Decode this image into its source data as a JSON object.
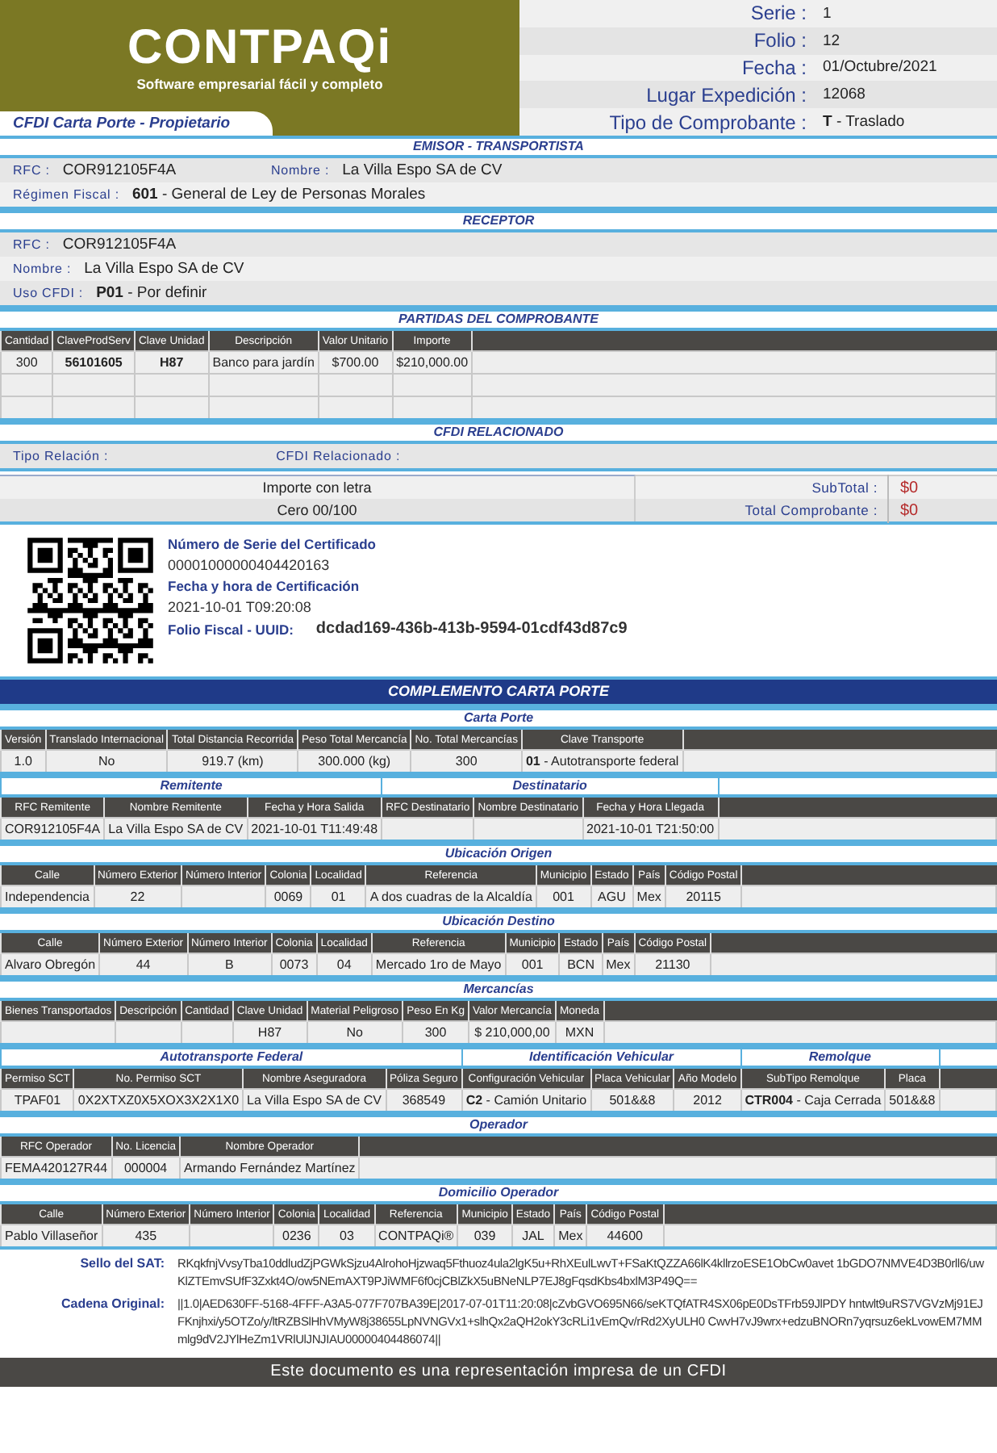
{
  "sections": [
    {
      "kind": "header",
      "logo": "CONTPAQi",
      "tagline": "Software empresarial fácil y completo",
      "doc_title": "CFDI Carta Porte - Propietario",
      "fields": [
        {
          "label": "Serie :",
          "value": "1"
        },
        {
          "label": "Folio :",
          "value": "12"
        },
        {
          "label": "Fecha :",
          "value": "01/Octubre/2021"
        },
        {
          "label": "Lugar Expedición :",
          "value": "12068"
        },
        {
          "label": "Tipo de Comprobante :",
          "value": "**T** - Traslado"
        }
      ]
    },
    {
      "kind": "title",
      "title": "EMISOR - TRANSPORTISTA"
    },
    {
      "kind": "fields",
      "rows": [
        [
          {
            "label": "RFC :",
            "value": "COR912105F4A"
          },
          {
            "label": "Nombre :",
            "value": "La Villa Espo SA de CV"
          }
        ],
        [
          {
            "label": "Régimen Fiscal :",
            "value": "**601** - General de Ley de Personas Morales"
          }
        ]
      ]
    },
    {
      "kind": "title",
      "title": "RECEPTOR"
    },
    {
      "kind": "fields",
      "rows": [
        [
          {
            "label": "RFC :",
            "value": "COR912105F4A"
          }
        ],
        [
          {
            "label": "Nombre :",
            "value": "La Villa Espo SA de CV"
          }
        ],
        [
          {
            "label": "Uso CFDI :",
            "value": "**P01** - Por definir"
          }
        ]
      ]
    },
    {
      "kind": "title",
      "title": "PARTIDAS DEL COMPROBANTE"
    },
    {
      "kind": "table",
      "columns": [
        {
          "label": "Cantidad",
          "bold": false
        },
        {
          "label": "ClaveProdServ",
          "bold": true
        },
        {
          "label": "Clave Unidad",
          "bold": true
        },
        {
          "label": "Descripción",
          "bold": false
        },
        {
          "label": "Valor Unitario",
          "bold": false
        },
        {
          "label": "Importe",
          "bold": false
        }
      ],
      "rows": [
        [
          "300",
          "56101605",
          "H87",
          "Banco para jardín",
          "$700.00",
          "$210,000.00"
        ],
        [
          null,
          null,
          null,
          null,
          null,
          null
        ],
        [
          null,
          null,
          null,
          null,
          null,
          null
        ]
      ]
    },
    {
      "kind": "title",
      "title": "CFDI RELACIONADO"
    },
    {
      "kind": "fields",
      "rows": [
        [
          {
            "label": "Tipo Relación :"
          },
          {
            "label": "CFDI Relacionado :"
          }
        ]
      ]
    },
    {
      "kind": "totals",
      "words_label": "Importe con letra",
      "words": "Cero  00/100",
      "subtotal_label": "SubTotal :",
      "subtotal": "$0",
      "total_label": "Total Comprobante :",
      "total": "$0"
    },
    {
      "kind": "certificate",
      "serial_label": "Número de Serie del Certificado",
      "serial": "00001000000404420163",
      "date_label": "Fecha y hora de Certificación",
      "date": "2021-10-01 T09:20:08",
      "uuid_label": "Folio  Fiscal  - UUID:",
      "uuid": "dcdad169-436b-413b-9594-01cdf43d87c9"
    },
    {
      "kind": "band",
      "title": "COMPLEMENTO CARTA PORTE"
    },
    {
      "kind": "title",
      "title": "Carta Porte"
    },
    {
      "kind": "table",
      "columns": [
        {
          "label": "Versión"
        },
        {
          "label": "Translado Internacional"
        },
        {
          "label": "Total Distancia Recorrida"
        },
        {
          "label": "Peso Total Mercancía"
        },
        {
          "label": "No. Total Mercancías"
        },
        {
          "label": "Clave Transporte"
        }
      ],
      "rows": [
        [
          "1.0",
          "No",
          "919.7 (km)",
          "300.000 (kg)",
          "300",
          "**01** - Autotransporte federal"
        ]
      ]
    },
    {
      "kind": "table",
      "groups": [
        {
          "title": "Remitente",
          "columns": [
            {
              "label": "RFC Remitente"
            },
            {
              "label": "Nombre Remitente"
            },
            {
              "label": "Fecha y Hora Salida"
            }
          ]
        },
        {
          "title": "Destinatario",
          "columns": [
            {
              "label": "RFC Destinatario"
            },
            {
              "label": "Nombre Destinatario"
            },
            {
              "label": "Fecha y Hora Llegada"
            }
          ]
        }
      ],
      "rows": [
        [
          "COR912105F4A",
          "La Villa Espo SA de CV",
          "2021-10-01 T11:49:48",
          null,
          null,
          "2021-10-01 T21:50:00"
        ]
      ]
    },
    {
      "kind": "title",
      "title": "Ubicación Origen"
    },
    {
      "kind": "table",
      "columns": [
        {
          "label": "Calle"
        },
        {
          "label": "Número Exterior"
        },
        {
          "label": "Número Interior"
        },
        {
          "label": "Colonia"
        },
        {
          "label": "Localidad"
        },
        {
          "label": "Referencia"
        },
        {
          "label": "Municipio"
        },
        {
          "label": "Estado"
        },
        {
          "label": "País"
        },
        {
          "label": "Código Postal"
        }
      ],
      "rows": [
        [
          "Independencia",
          "22",
          null,
          "0069",
          "01",
          "A dos cuadras de la Alcaldía",
          "001",
          "AGU",
          "Mex",
          "20115"
        ]
      ]
    },
    {
      "kind": "title",
      "title": "Ubicación Destino"
    },
    {
      "kind": "table",
      "columns": [
        {
          "label": "Calle"
        },
        {
          "label": "Número Exterior"
        },
        {
          "label": "Número Interior"
        },
        {
          "label": "Colonia"
        },
        {
          "label": "Localidad"
        },
        {
          "label": "Referencia"
        },
        {
          "label": "Municipio"
        },
        {
          "label": "Estado"
        },
        {
          "label": "País"
        },
        {
          "label": "Código Postal"
        }
      ],
      "rows": [
        [
          "Alvaro Obregón",
          "44",
          "B",
          "0073",
          "04",
          "Mercado 1ro de Mayo",
          "001",
          "BCN",
          "Mex",
          "21130"
        ]
      ]
    },
    {
      "kind": "title",
      "title": "Mercancías"
    },
    {
      "kind": "table",
      "columns": [
        {
          "label": "Bienes Transportados"
        },
        {
          "label": "Descripción"
        },
        {
          "label": "Cantidad"
        },
        {
          "label": "Clave Unidad"
        },
        {
          "label": "Material Peligroso"
        },
        {
          "label": "Peso En Kg"
        },
        {
          "label": "Valor Mercancía"
        },
        {
          "label": "Moneda"
        }
      ],
      "rows": [
        [
          null,
          null,
          null,
          "H87",
          "No",
          "300",
          "$ 210,000,00",
          "MXN"
        ]
      ]
    },
    {
      "kind": "table",
      "groups": [
        {
          "title": "Autotransporte Federal",
          "columns": [
            {
              "label": "Permiso SCT"
            },
            {
              "label": "No. Permiso SCT"
            },
            {
              "label": "Nombre Aseguradora"
            },
            {
              "label": "Póliza Seguro"
            }
          ]
        },
        {
          "title": "Identificación Vehicular",
          "columns": [
            {
              "label": "Configuración Vehicular"
            },
            {
              "label": "Placa Vehicular"
            },
            {
              "label": "Año Modelo"
            }
          ]
        },
        {
          "title": "Remolque",
          "columns": [
            {
              "label": "SubTipo Remolque"
            },
            {
              "label": "Placa"
            }
          ]
        }
      ],
      "rows": [
        [
          "TPAF01",
          "0X2XTXZ0X5XOX3X2X1X0",
          "La Villa Espo SA de CV",
          "368549",
          "**C2** - Camión Unitario",
          "501&&8",
          "2012",
          "**CTR004** - Caja Cerrada",
          "501&&8"
        ]
      ]
    },
    {
      "kind": "title",
      "title": "Operador"
    },
    {
      "kind": "table",
      "columns": [
        {
          "label": "RFC Operador"
        },
        {
          "label": "No. Licencia"
        },
        {
          "label": "Nombre Operador"
        }
      ],
      "rows": [
        [
          "FEMA420127R44",
          "000004",
          "Armando Fernández Martínez"
        ]
      ]
    },
    {
      "kind": "title",
      "title": "Domicilio Operador"
    },
    {
      "kind": "table",
      "columns": [
        {
          "label": "Calle"
        },
        {
          "label": "Número Exterior"
        },
        {
          "label": "Número Interior"
        },
        {
          "label": "Colonia"
        },
        {
          "label": "Localidad"
        },
        {
          "label": "Referencia"
        },
        {
          "label": "Municipio"
        },
        {
          "label": "Estado"
        },
        {
          "label": "País"
        },
        {
          "label": "Código Postal"
        }
      ],
      "rows": [
        [
          "Pablo Villaseñor",
          "435",
          null,
          "0236",
          "03",
          "CONTPAQi®",
          "039",
          "JAL",
          "Mex",
          "44600"
        ]
      ]
    },
    {
      "kind": "seals",
      "items": [
        {
          "label": "Sello del SAT:",
          "value": "RKqkfnjVvsyTba10ddludZjPGWkSjzu4AlrohoHjzwaq5Fthuoz4ula2lgK5u+RhXEulLwvT+FSaKtQZZA66lK4kllrzoESE1ObCw0avet 1bGDO7NMVE4D3B0rll6/uwKlZTEmvSUfF3Zxkt4O/ow5NEmAXT9PJiWMF6f0cjCBlZkX5uBNeNLP7EJ8gFqsdKbs4bxlM3P49Q=="
        },
        {
          "label": "Cadena Original:",
          "value": "||1.0|AED630FF-5168-4FFF-A3A5-077F707BA39E|2017-07-01T11:20:08|cZvbGVO695N66/seKTQfATR4SX06pE0DsTFrb59JlPDY hntwlt9uRS7VGVzMj91EJFKnjhxi/y5OTZo/y/ltRZBSlHhVMyW8j38655LpNVNGVx1+slhQx2aQH2okY3cRLi1vEmQv/rRd2XyULH0 CwvH7vJ9wrx+edzuBNORn7yqrsuz6ekLvowEM7MMmlg9dV2JYlHeZm1VRlUlJNJIAU00000404486074||"
        }
      ]
    },
    {
      "kind": "footer",
      "text": "Este documento es una representación impresa de un CFDI"
    }
  ]
}
